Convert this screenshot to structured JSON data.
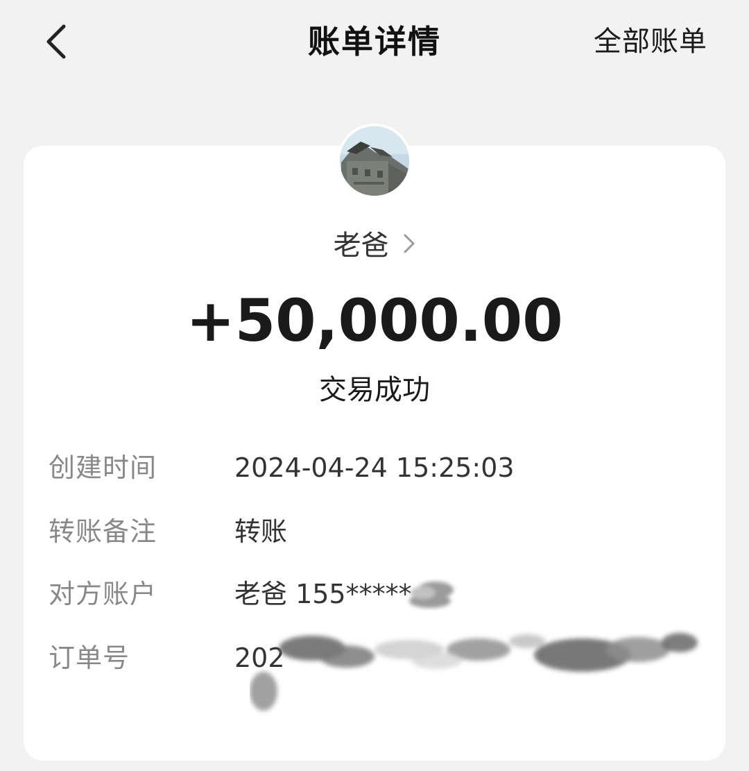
{
  "header": {
    "title": "账单详情",
    "all_bills_label": "全部账单"
  },
  "icons": {
    "back": "chevron-left-icon",
    "payer_chevron": "chevron-right-icon"
  },
  "counterparty": {
    "name": "老爸"
  },
  "transaction": {
    "amount": "+50,000.00",
    "status": "交易成功"
  },
  "details": [
    {
      "label": "创建时间",
      "value": "2024-04-24 15:25:03"
    },
    {
      "label": "转账备注",
      "value": "转账"
    },
    {
      "label": "对方账户",
      "value": "老爸 155*****"
    },
    {
      "label": "订单号",
      "value": "202"
    }
  ],
  "colors": {
    "background": "#f2f2f2",
    "card": "#ffffff",
    "label_gray": "#888888",
    "text_dark": "#1a1a1a"
  }
}
